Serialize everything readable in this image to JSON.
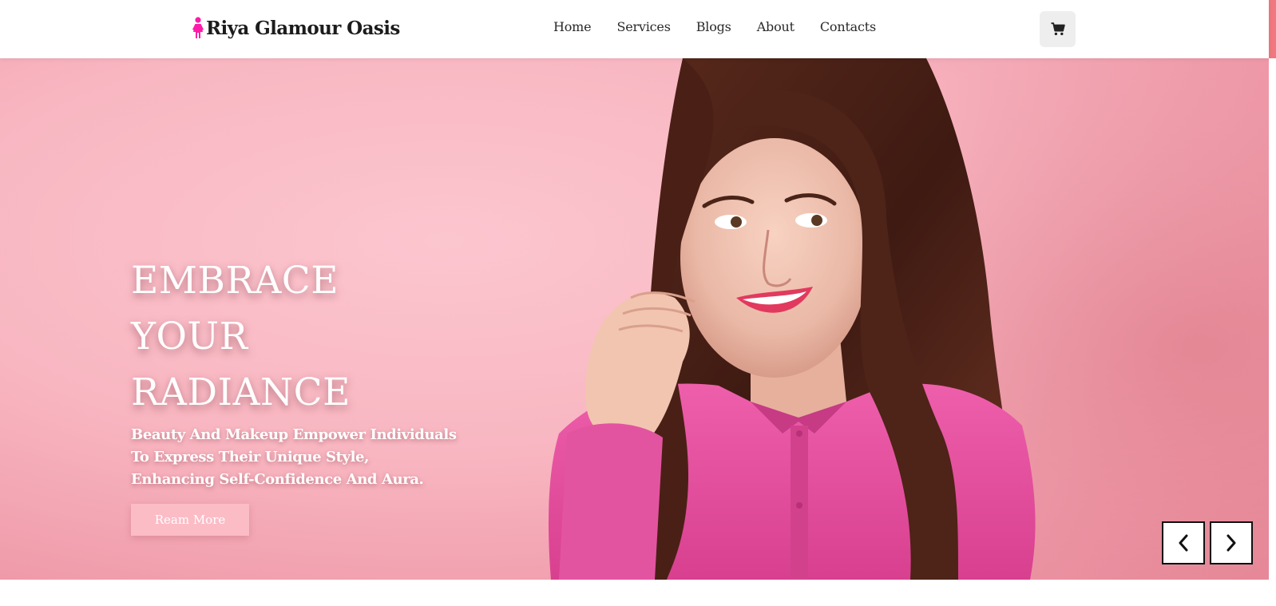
{
  "header": {
    "brand_name": "Riya Glamour Oasis",
    "brand_icon": "woman-icon",
    "brand_color": "#ff1aa8",
    "nav": [
      {
        "label": "Home"
      },
      {
        "label": "Services"
      },
      {
        "label": "Blogs"
      },
      {
        "label": "About"
      },
      {
        "label": "Contacts"
      }
    ],
    "cart_icon": "cart-icon"
  },
  "hero": {
    "title_lines": [
      "EMBRACE",
      "YOUR",
      "RADIANCE"
    ],
    "subtitle_lines": [
      "Beauty And Makeup Empower Individuals",
      "To Express Their Unique Style,",
      "Enhancing Self-Confidence And Aura."
    ],
    "button_label": "Ream More",
    "background_color": "#f8b6c1",
    "prev_icon": "chevron-left-icon",
    "next_icon": "chevron-right-icon"
  },
  "colors": {
    "accent": "#f0787e",
    "button_bg": "#fbbcc6",
    "cart_bg": "#eeeeee"
  }
}
